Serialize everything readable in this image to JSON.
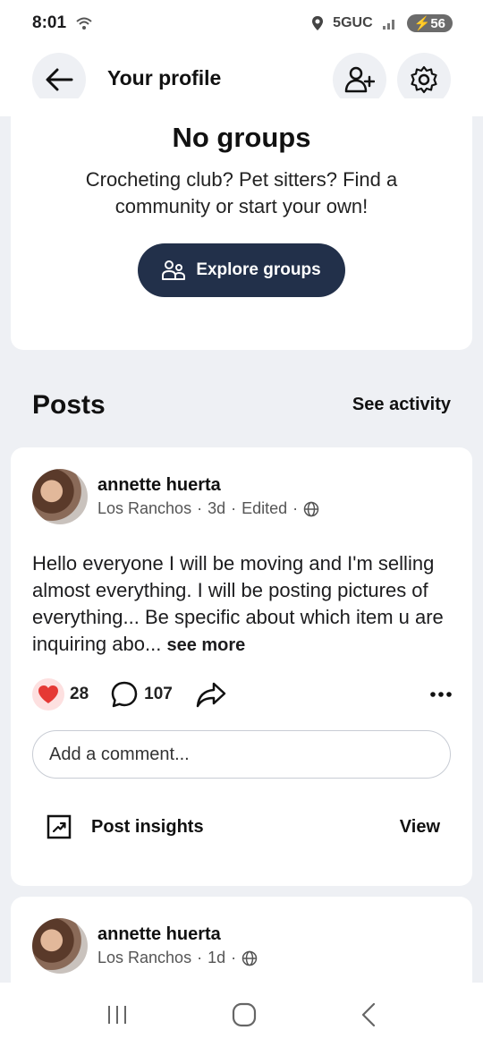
{
  "status_bar": {
    "time": "8:01",
    "network": "5GUC",
    "battery": "56"
  },
  "header": {
    "title": "Your profile"
  },
  "groups": {
    "title": "No groups",
    "description": "Crocheting club? Pet sitters? Find a community or start your own!",
    "button_label": "Explore groups"
  },
  "posts_section": {
    "title": "Posts",
    "see_activity": "See activity"
  },
  "posts": [
    {
      "author": "annette huerta",
      "location": "Los Ranchos",
      "time": "3d",
      "edited": "Edited",
      "body": "Hello everyone I will be moving and I'm selling almost everything. I will be posting pictures of everything... Be specific about which item u are inquiring abo...",
      "see_more": "see more",
      "likes": "28",
      "comments": "107",
      "comment_placeholder": "Add a comment...",
      "insights_label": "Post insights",
      "insights_view": "View"
    },
    {
      "author": "annette huerta",
      "location": "Los Ranchos",
      "time": "1d"
    }
  ],
  "colors": {
    "primary_button": "#22304a",
    "background": "#eef0f4",
    "like": "#e53935"
  }
}
